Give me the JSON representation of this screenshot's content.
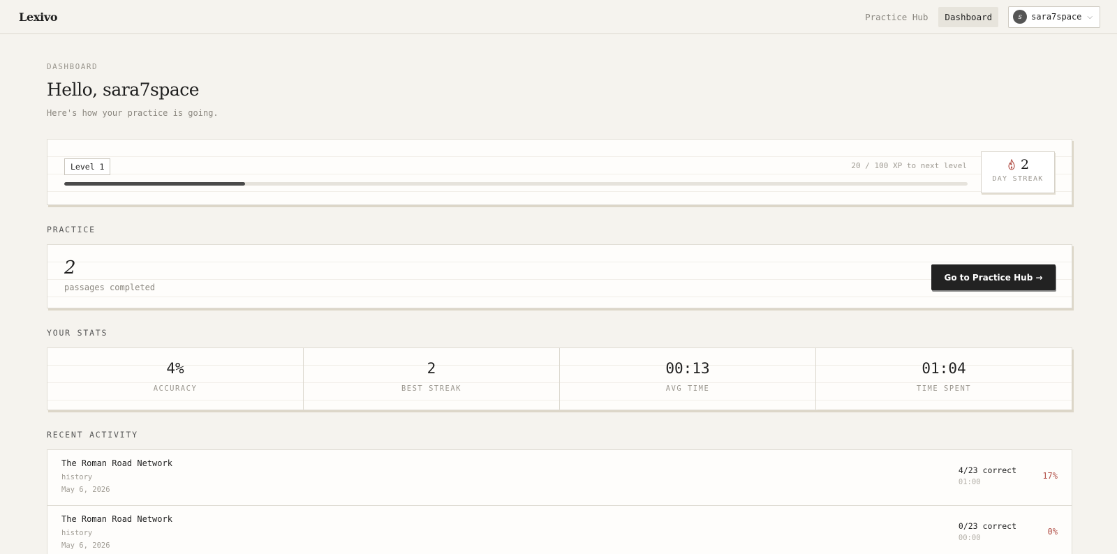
{
  "brand": "Lexivo",
  "nav": {
    "practice_hub": "Practice Hub",
    "dashboard": "Dashboard",
    "user_initial": "s",
    "username": "sara7space",
    "chevron": "⌵"
  },
  "header": {
    "eyebrow": "DASHBOARD",
    "greeting": "Hello, sara7space",
    "subtitle": "Here's how your practice is going."
  },
  "level": {
    "badge": "Level 1",
    "xp_text": "20 / 100 XP to next level",
    "xp_progress": 0.2,
    "streak_value": "2",
    "streak_label": "DAY STREAK",
    "streak_icon": "flame-icon"
  },
  "practice": {
    "section_title": "PRACTICE",
    "count": "2",
    "label": "passages completed",
    "button": "Go to Practice Hub →"
  },
  "stats": {
    "section_title": "YOUR STATS",
    "items": [
      {
        "value": "4%",
        "label": "ACCURACY"
      },
      {
        "value": "2",
        "label": "BEST STREAK"
      },
      {
        "value": "00:13",
        "label": "AVG TIME"
      },
      {
        "value": "01:04",
        "label": "TIME SPENT"
      }
    ]
  },
  "activity": {
    "section_title": "RECENT ACTIVITY",
    "rows": [
      {
        "title": "The Roman Road Network",
        "category": "history",
        "date": "May 6, 2026",
        "correct": "4/23 correct",
        "time": "01:00",
        "pct": "17%"
      },
      {
        "title": "The Roman Road Network",
        "category": "history",
        "date": "May 6, 2026",
        "correct": "0/23 correct",
        "time": "00:00",
        "pct": "0%"
      }
    ]
  },
  "colors": {
    "background": "#f5f3ee",
    "accent_dark": "#222222",
    "flame": "#b3524a",
    "percent": "#b3524a"
  }
}
